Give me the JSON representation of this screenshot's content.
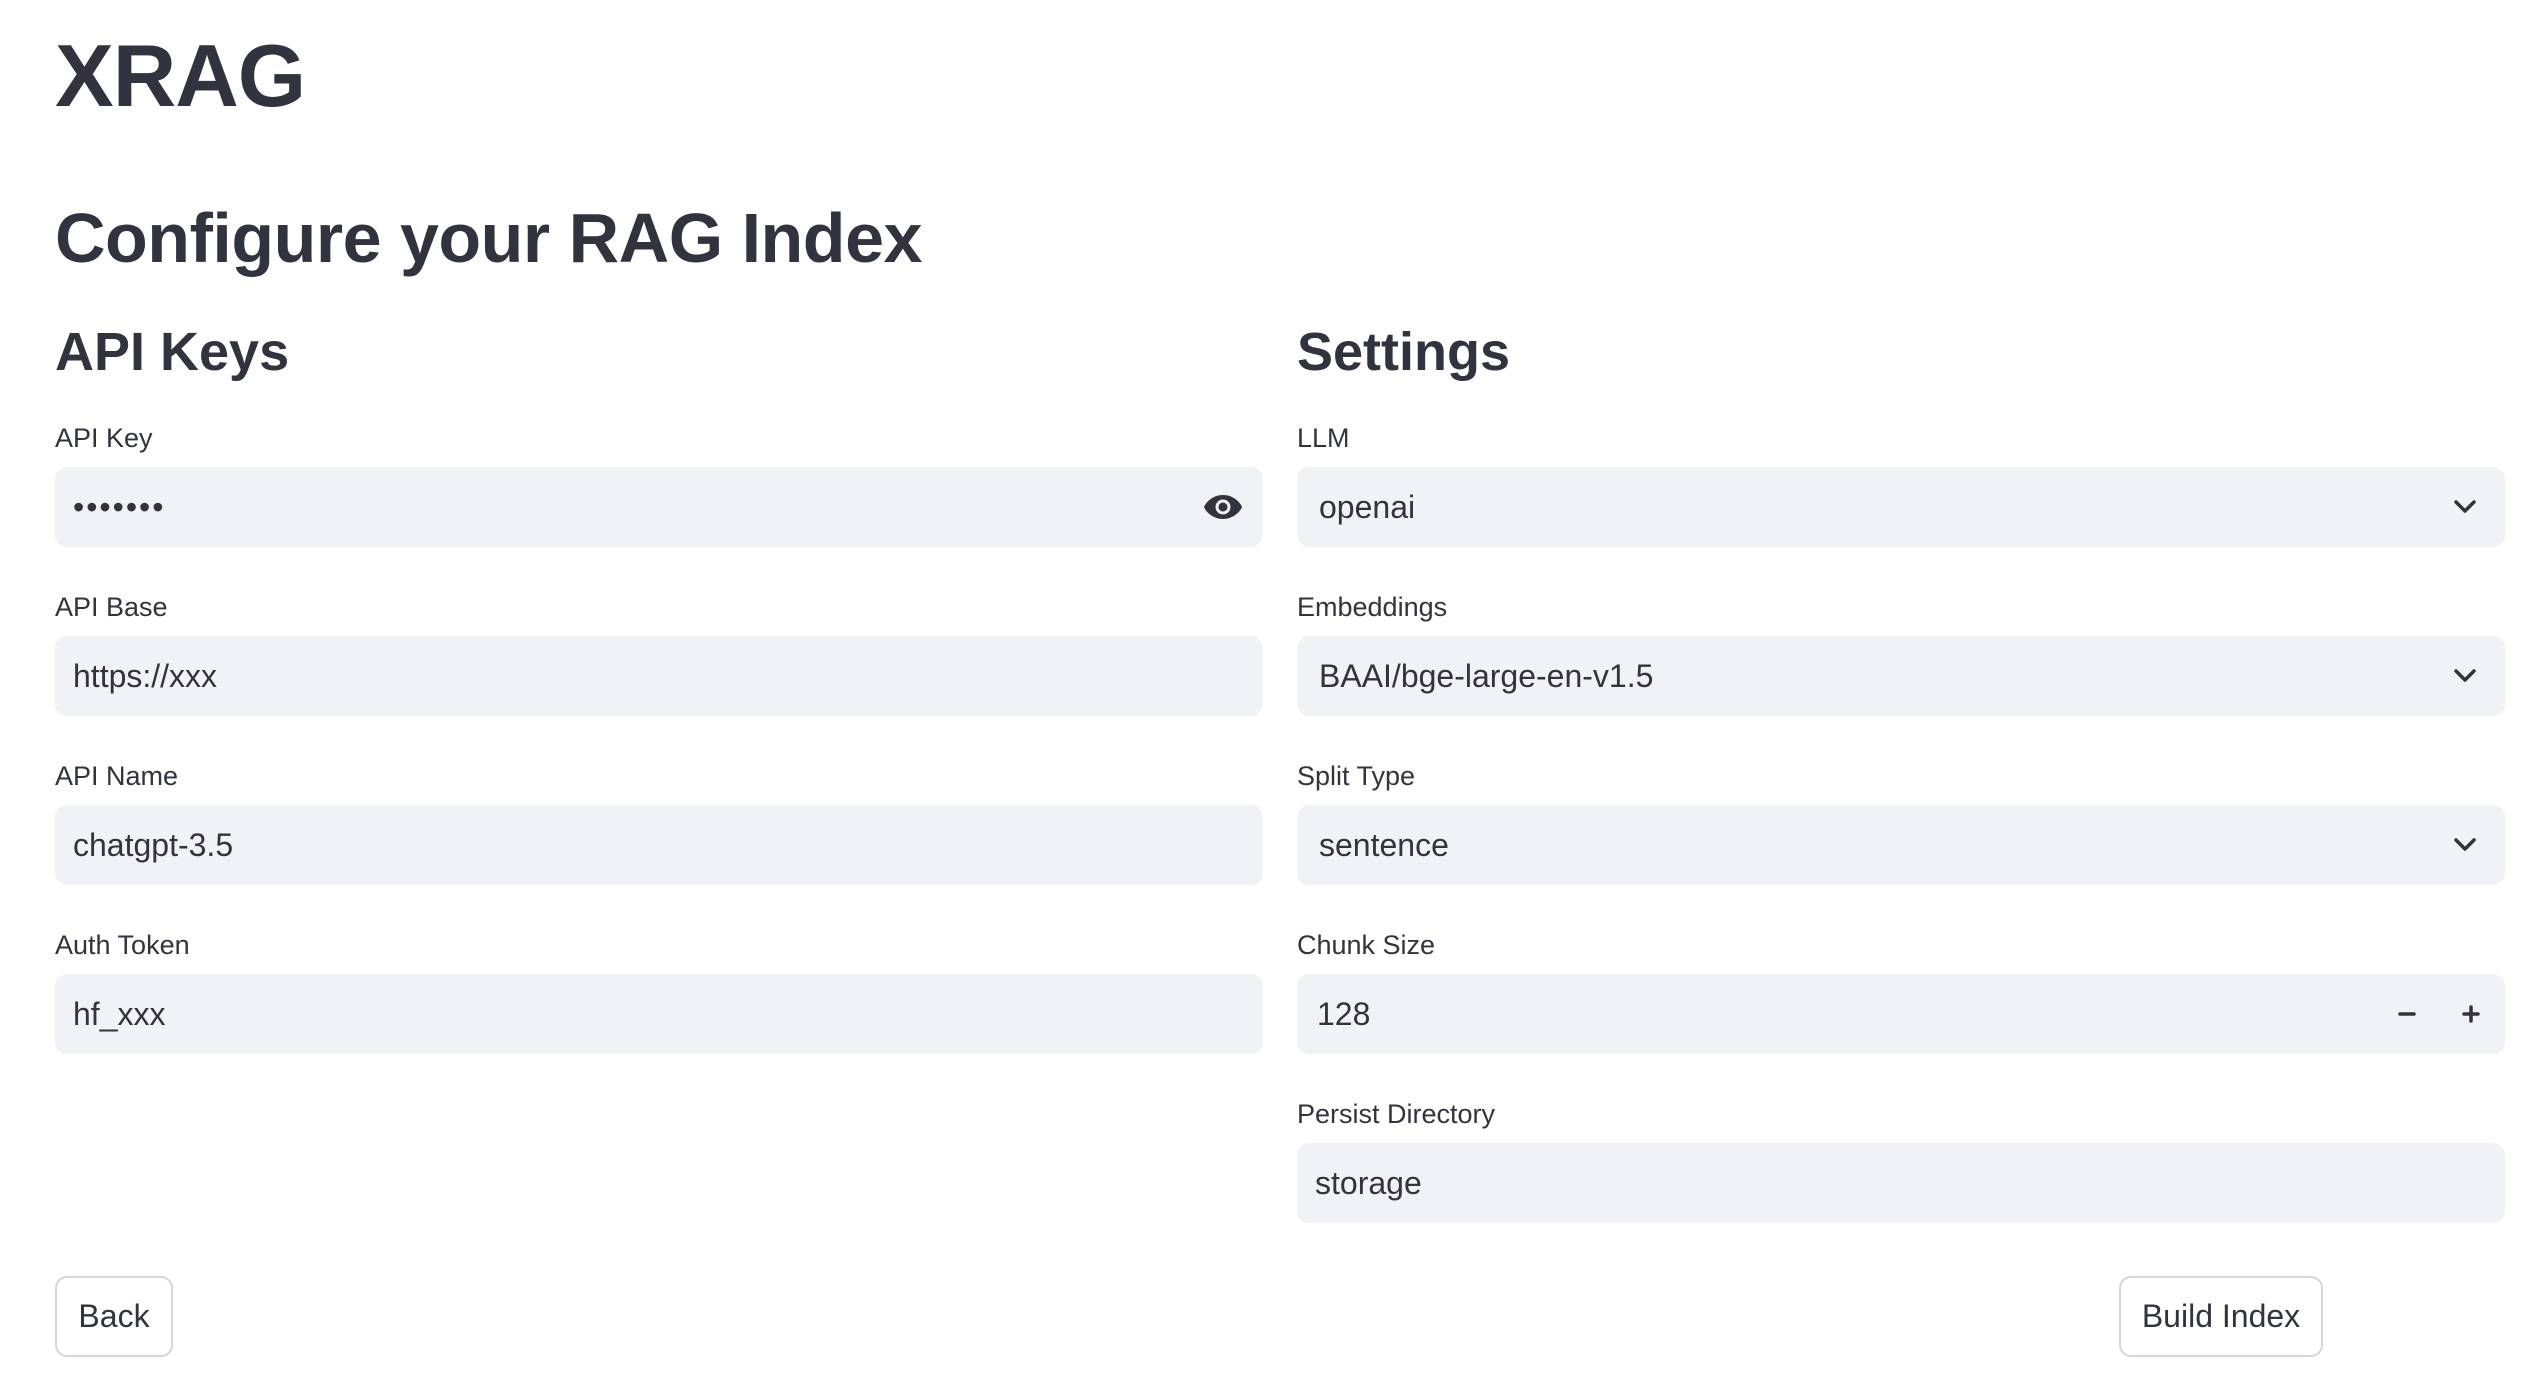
{
  "app": {
    "title": "XRAG"
  },
  "page": {
    "title": "Configure your RAG Index"
  },
  "api_keys": {
    "title": "API Keys",
    "api_key": {
      "label": "API Key",
      "value": "•••••••"
    },
    "api_base": {
      "label": "API Base",
      "value": "https://xxx"
    },
    "api_name": {
      "label": "API Name",
      "value": "chatgpt-3.5"
    },
    "auth_token": {
      "label": "Auth Token",
      "value": "hf_xxx"
    }
  },
  "settings": {
    "title": "Settings",
    "llm": {
      "label": "LLM",
      "value": "openai"
    },
    "embeddings": {
      "label": "Embeddings",
      "value": "BAAI/bge-large-en-v1.5"
    },
    "split_type": {
      "label": "Split Type",
      "value": "sentence"
    },
    "chunk_size": {
      "label": "Chunk Size",
      "value": "128"
    },
    "persist_directory": {
      "label": "Persist Directory",
      "value": "storage"
    }
  },
  "buttons": {
    "back": "Back",
    "build_index": "Build Index"
  },
  "icons": {
    "password_toggle": "eye-icon",
    "select_arrow": "chevron-down-icon",
    "decrement": "minus-icon",
    "increment": "plus-icon"
  },
  "colors": {
    "text": "#31333f",
    "input_bg": "#f0f2f6",
    "button_border": "#d6d6d9"
  }
}
